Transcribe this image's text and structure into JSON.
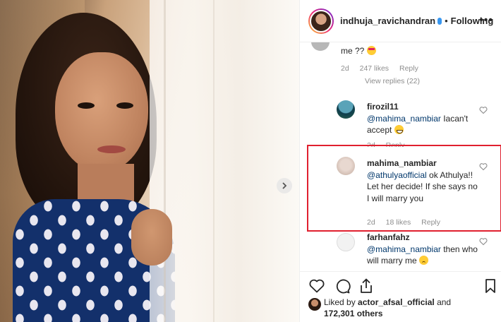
{
  "header": {
    "username": "indhuja_ravichandran",
    "separator": "•",
    "follow_label": "Following",
    "more_label": "•••"
  },
  "comments": [
    {
      "text": "me ??",
      "emoji": "heart-eyes-emoji",
      "time": "2d",
      "likes": "247 likes",
      "reply": "Reply",
      "view_replies": "View replies (22)"
    },
    {
      "username": "firozil11",
      "mention": "@mahima_nambiar",
      "text": " Iacan't accept",
      "emoji": "grin-emoji",
      "time": "2d",
      "reply": "Reply"
    },
    {
      "username": "mahima_nambiar",
      "mention": "@athulyaofficial",
      "text": " ok Athulya!! Let her decide! If she says no I will marry you",
      "time": "2d",
      "likes": "18 likes",
      "reply": "Reply"
    },
    {
      "username": "farhanfahz",
      "mention": "@mahima_nambiar",
      "text": " then who will marry me",
      "emoji": "sad-emoji"
    }
  ],
  "actions": {
    "like_icon": "heart-icon",
    "comment_icon": "comment-icon",
    "share_icon": "share-icon",
    "save_icon": "bookmark-icon"
  },
  "likes_summary": {
    "prefix": "Liked by ",
    "user": "actor_afsal_official",
    "connector": " and",
    "count": "172,301 others"
  },
  "colors": {
    "highlight_border": "#e0202f",
    "mention": "#00376b",
    "muted": "#8e8e8e"
  }
}
